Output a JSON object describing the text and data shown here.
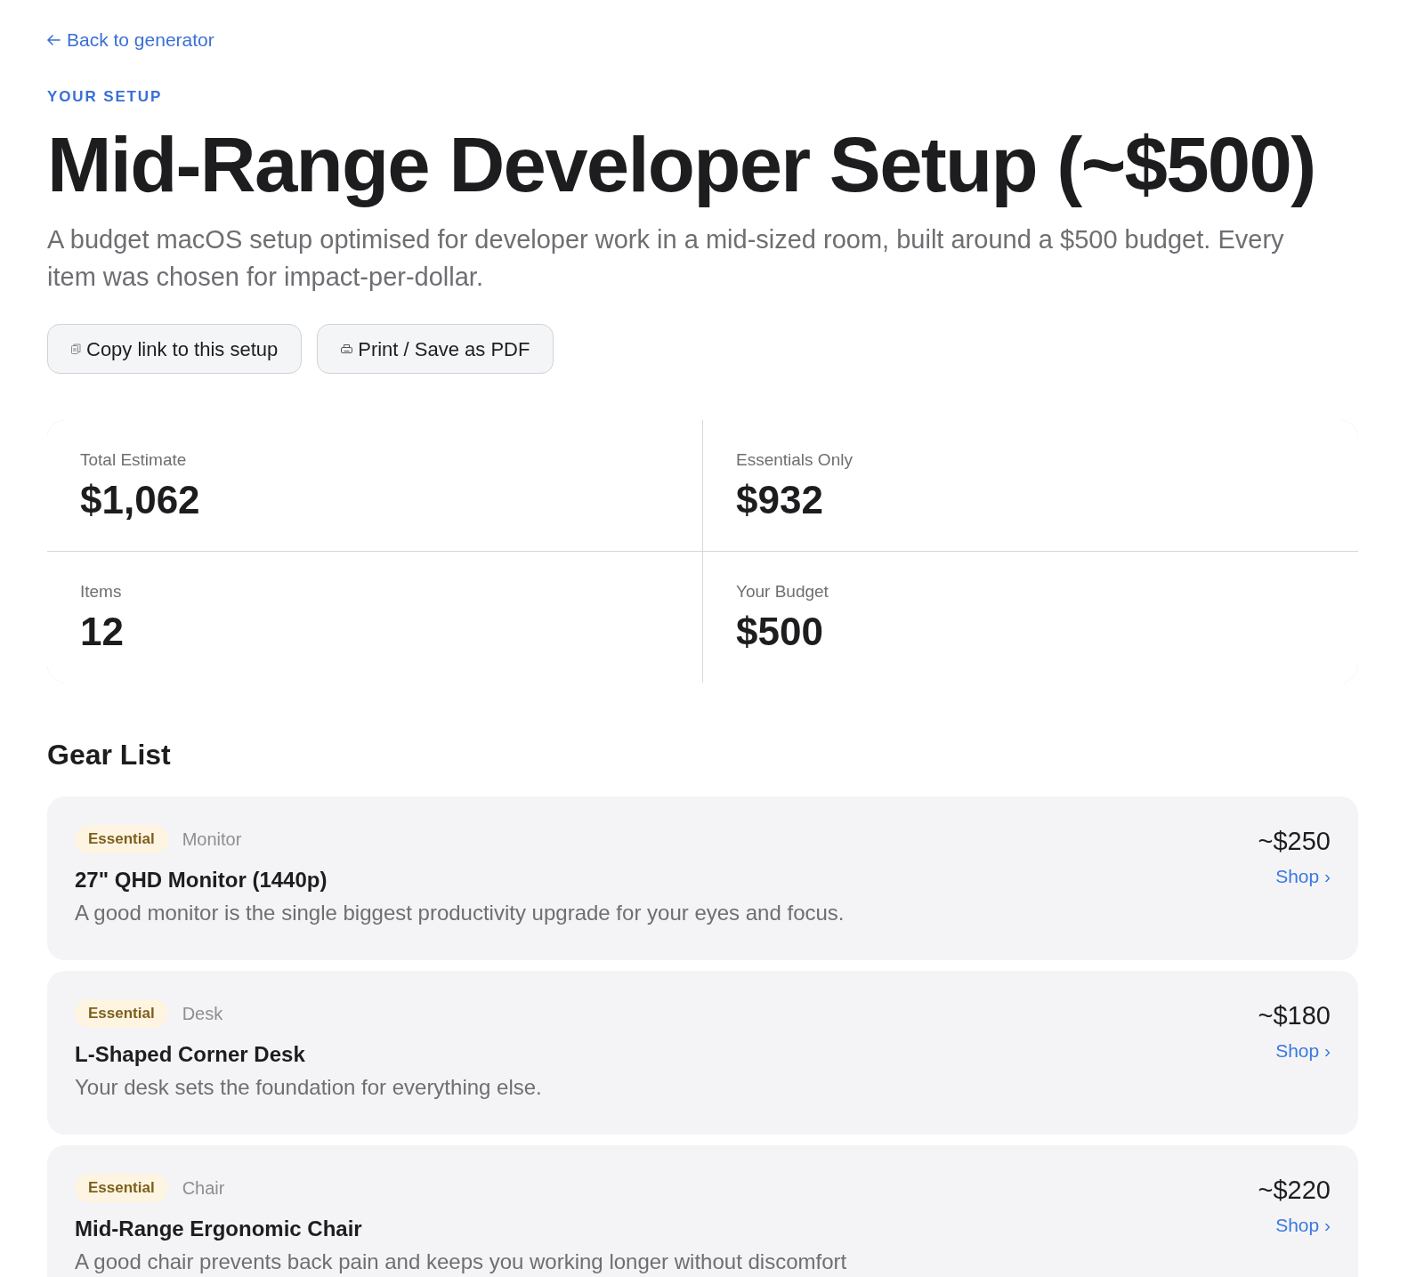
{
  "back_link": {
    "label": "Back to generator"
  },
  "eyebrow": "YOUR SETUP",
  "title": "Mid-Range Developer Setup (~$500)",
  "subtitle": "A budget macOS setup optimised for developer work in a mid-sized room, built around a $500 budget. Every item was chosen for impact-per-dollar.",
  "actions": [
    {
      "kind": "copy",
      "label": "Copy link to this setup"
    },
    {
      "kind": "print",
      "label": "Print / Save as PDF"
    }
  ],
  "stats": [
    {
      "label": "Total Estimate",
      "value": "$1,062"
    },
    {
      "label": "Essentials Only",
      "value": "$932"
    },
    {
      "label": "Items",
      "value": "12"
    },
    {
      "label": "Your Budget",
      "value": "$500"
    }
  ],
  "gear_list": {
    "title": "Gear List",
    "items": [
      {
        "badge": "Essential",
        "category": "Monitor",
        "name": "27\" QHD Monitor (1440p)",
        "description": "A good monitor is the single biggest productivity upgrade for your eyes and focus.",
        "price": "~$250",
        "link": "Shop ›"
      },
      {
        "badge": "Essential",
        "category": "Desk",
        "name": "L-Shaped Corner Desk",
        "description": "Your desk sets the foundation for everything else.",
        "price": "~$180",
        "link": "Shop ›"
      },
      {
        "badge": "Essential",
        "category": "Chair",
        "name": "Mid-Range Ergonomic Chair",
        "description": "A good chair prevents back pain and keeps you working longer without discomfort",
        "price": "~$220",
        "link": "Shop ›"
      }
    ]
  }
}
